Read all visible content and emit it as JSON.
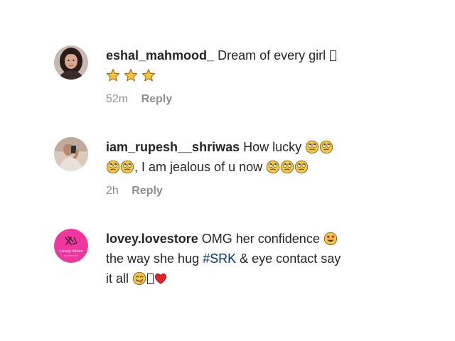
{
  "comments": [
    {
      "username": "eshal_mahmood_",
      "text": "Dream of every girl",
      "emojis": [
        "missing-glyph",
        "star-icon",
        "star-icon",
        "star-icon"
      ],
      "time": "52m",
      "reply_label": "Reply"
    },
    {
      "username": "iam_rupesh__shriwas",
      "text_part1": "How lucky",
      "text_part2": ", I am jealous of u now",
      "emojis": [
        "rolling-eyes-icon"
      ],
      "time": "2h",
      "reply_label": "Reply"
    },
    {
      "username": "lovey.lovestore",
      "text_part1": "OMG her confidence",
      "text_part2": "the way she hug",
      "hashtag": "#SRK",
      "text_part3": "& eye contact say",
      "text_part4": "it all",
      "emojis": [
        "heart-eyes-icon",
        "yum-face-icon",
        "missing-glyph",
        "red-heart-icon"
      ],
      "avatar_brand_text": "Lovey Store"
    }
  ],
  "colors": {
    "username": "#262626",
    "meta": "#8e8e8e",
    "hashtag": "#00376b",
    "avatar3_bg": "#f0379f",
    "star": "#f6c33b",
    "heart": "#e0242d"
  }
}
